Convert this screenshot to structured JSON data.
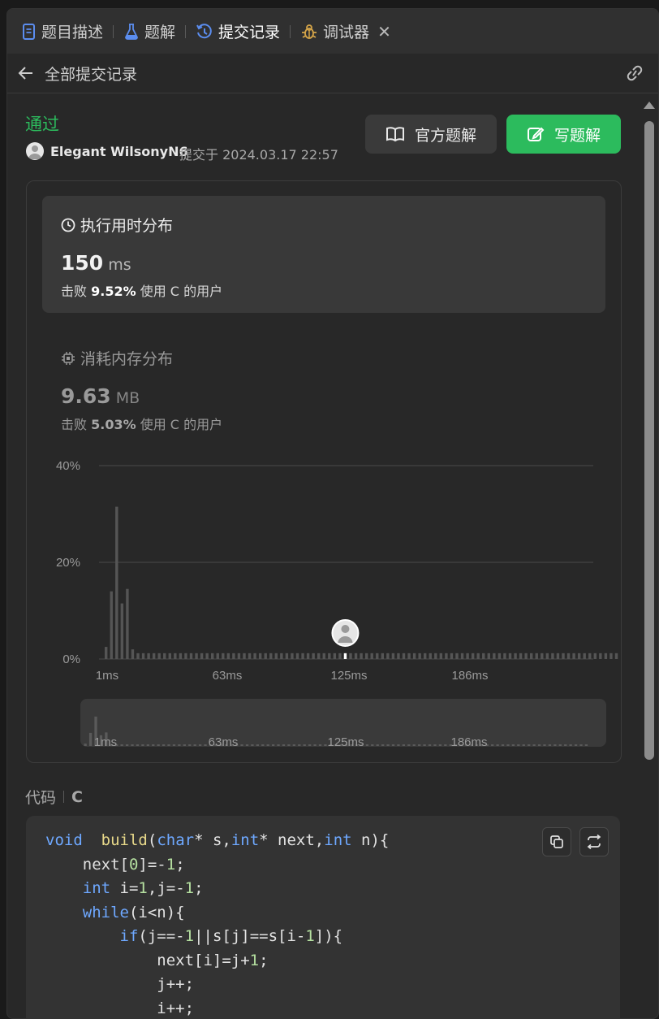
{
  "tabs": [
    {
      "label": "题目描述",
      "icon": "document-icon"
    },
    {
      "label": "题解",
      "icon": "flask-icon"
    },
    {
      "label": "提交记录",
      "icon": "history-icon",
      "active": true
    },
    {
      "label": "调试器",
      "icon": "bug-icon"
    }
  ],
  "header": {
    "title": "全部提交记录"
  },
  "submission": {
    "status": "通过",
    "user": "Elegant WilsonyN6",
    "submitted_at": "提交于 2024.03.17 22:57"
  },
  "buttons": {
    "official": "官方题解",
    "write": "写题解"
  },
  "runtime": {
    "title": "执行用时分布",
    "value": "150",
    "unit": "ms",
    "beat_prefix": "击败",
    "beat_pct": "9.52%",
    "beat_suffix": "使用 C 的用户"
  },
  "memory": {
    "title": "消耗内存分布",
    "value": "9.63",
    "unit": "MB",
    "beat_prefix": "击败",
    "beat_pct": "5.03%",
    "beat_suffix": "使用 C 的用户"
  },
  "chart_data": {
    "type": "bar",
    "y_ticks": [
      "40%",
      "20%",
      "0%"
    ],
    "ylim": [
      0,
      40
    ],
    "x_ticks": [
      "1ms",
      "63ms",
      "125ms",
      "186ms"
    ],
    "values": [
      2.5,
      14,
      31.5,
      11.5,
      14.5,
      2,
      1.2,
      1.2,
      1.2,
      1.2,
      1.2,
      1.2,
      1.2,
      1.2,
      1.2,
      1.2,
      1.2,
      1.2,
      1.2,
      1.2,
      1.2,
      1.2,
      1.2,
      1.2,
      1.2,
      1.2,
      1.2,
      1.2,
      1.2,
      1.2,
      1.2,
      1.2,
      1.2,
      1.2,
      1.2,
      1.2,
      1.2,
      1.2,
      1.2,
      1.2,
      1.2,
      1.2,
      1.2,
      1.2,
      1.2,
      1.2,
      1.2,
      1.2,
      1.2,
      1.2,
      1.2,
      1.2,
      1.2,
      1.2,
      1.2,
      1.2,
      1.2,
      1.2,
      1.2,
      1.2,
      1.2,
      1.2,
      1.2,
      1.2,
      1.2,
      1.2,
      1.2,
      1.2,
      1.2,
      1.2,
      1.2,
      1.2,
      1.2,
      1.2,
      1.2,
      1.2,
      1.2,
      1.2,
      1.2,
      1.2,
      1.2,
      1.2,
      1.2,
      1.2,
      1.2,
      1.2,
      1.2,
      1.2,
      1.2,
      1.2,
      1.2,
      1.2,
      1.2,
      1.2,
      1.2,
      1.2,
      1.2
    ],
    "highlight_index": 45,
    "grid": true
  },
  "code": {
    "label": "代码",
    "language": "C",
    "lines": [
      [
        [
          "kw",
          "void"
        ],
        [
          "",
          "  "
        ],
        [
          "fn",
          "build"
        ],
        [
          "",
          "("
        ],
        [
          "kw",
          "char"
        ],
        [
          "",
          "* s,"
        ],
        [
          "kw",
          "int"
        ],
        [
          "",
          "* next,"
        ],
        [
          "kw",
          "int"
        ],
        [
          "",
          " n){"
        ]
      ],
      [
        [
          "",
          "    next["
        ],
        [
          "num",
          "0"
        ],
        [
          "",
          "]=-"
        ],
        [
          "num",
          "1"
        ],
        [
          "",
          ";"
        ]
      ],
      [
        [
          "",
          "    "
        ],
        [
          "kw",
          "int"
        ],
        [
          "",
          " i="
        ],
        [
          "num",
          "1"
        ],
        [
          "",
          ",j=-"
        ],
        [
          "num",
          "1"
        ],
        [
          "",
          ";"
        ]
      ],
      [
        [
          "",
          "    "
        ],
        [
          "kw",
          "while"
        ],
        [
          "",
          "(i<n){"
        ]
      ],
      [
        [
          "",
          "        "
        ],
        [
          "kw",
          "if"
        ],
        [
          "",
          "(j==-"
        ],
        [
          "num",
          "1"
        ],
        [
          "",
          "||s[j]==s[i-"
        ],
        [
          "num",
          "1"
        ],
        [
          "",
          "]){"
        ]
      ],
      [
        [
          "",
          "            next[i]=j+"
        ],
        [
          "num",
          "1"
        ],
        [
          "",
          ";"
        ]
      ],
      [
        [
          "",
          "            j++;"
        ]
      ],
      [
        [
          "",
          "            i++;"
        ]
      ]
    ]
  }
}
